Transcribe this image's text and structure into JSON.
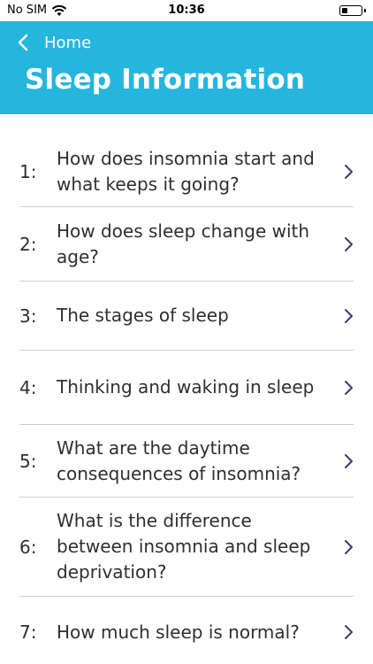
{
  "status_bar": {
    "carrier": "No SIM",
    "time": "10:36",
    "wifi_icon": "wifi-icon",
    "battery_icon": "battery-icon"
  },
  "header": {
    "back_label": "Home",
    "title": "Sleep Information",
    "background_color": "#26b6dd"
  },
  "items": [
    {
      "number": "1:",
      "title": "How does insomnia start and what keeps it going?"
    },
    {
      "number": "2:",
      "title": "How does sleep change with age?"
    },
    {
      "number": "3:",
      "title": "The stages of sleep"
    },
    {
      "number": "4:",
      "title": "Thinking and waking in sleep"
    },
    {
      "number": "5:",
      "title": "What are the daytime consequences of insomnia?"
    },
    {
      "number": "6:",
      "title": "What is the difference between insomnia and sleep deprivation?"
    },
    {
      "number": "7:",
      "title": "How much sleep is normal?"
    }
  ],
  "chevron_color": "#3d3a6e"
}
